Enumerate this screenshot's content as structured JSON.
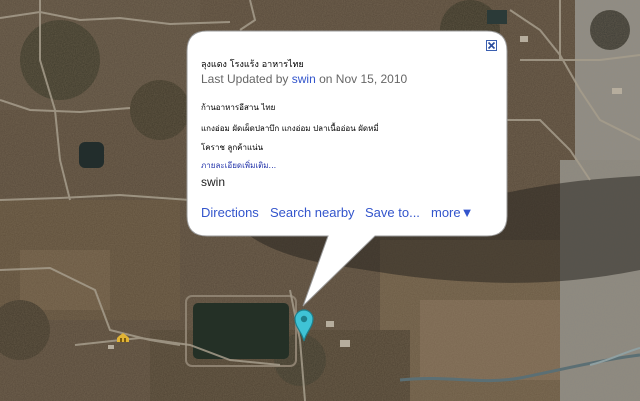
{
  "info_window": {
    "title": "ลุงแดง โรงแร้ง อาหารไทย",
    "updated_prefix": "Last Updated by",
    "updated_user": "swin",
    "updated_on": "on Nov 15, 2010",
    "desc_lines": [
      "ก้านอาหารอีสาน ไทย",
      "แกงอ่อม ผัดเผ็ดปลาบึก แกงอ่อม ปลาเนื้ออ่อน ผัดหมี่",
      "โคราช ลูกค้าแน่น"
    ],
    "more_link": "ภายละเอียดเพิ่มเติม...",
    "author": "swin",
    "actions": {
      "directions": "Directions",
      "search_nearby": "Search nearby",
      "save_to": "Save to...",
      "more": "more▼"
    }
  },
  "map": {
    "style": "satellite",
    "marker_color": "#3fc3d6",
    "close_icon": "close-icon"
  }
}
